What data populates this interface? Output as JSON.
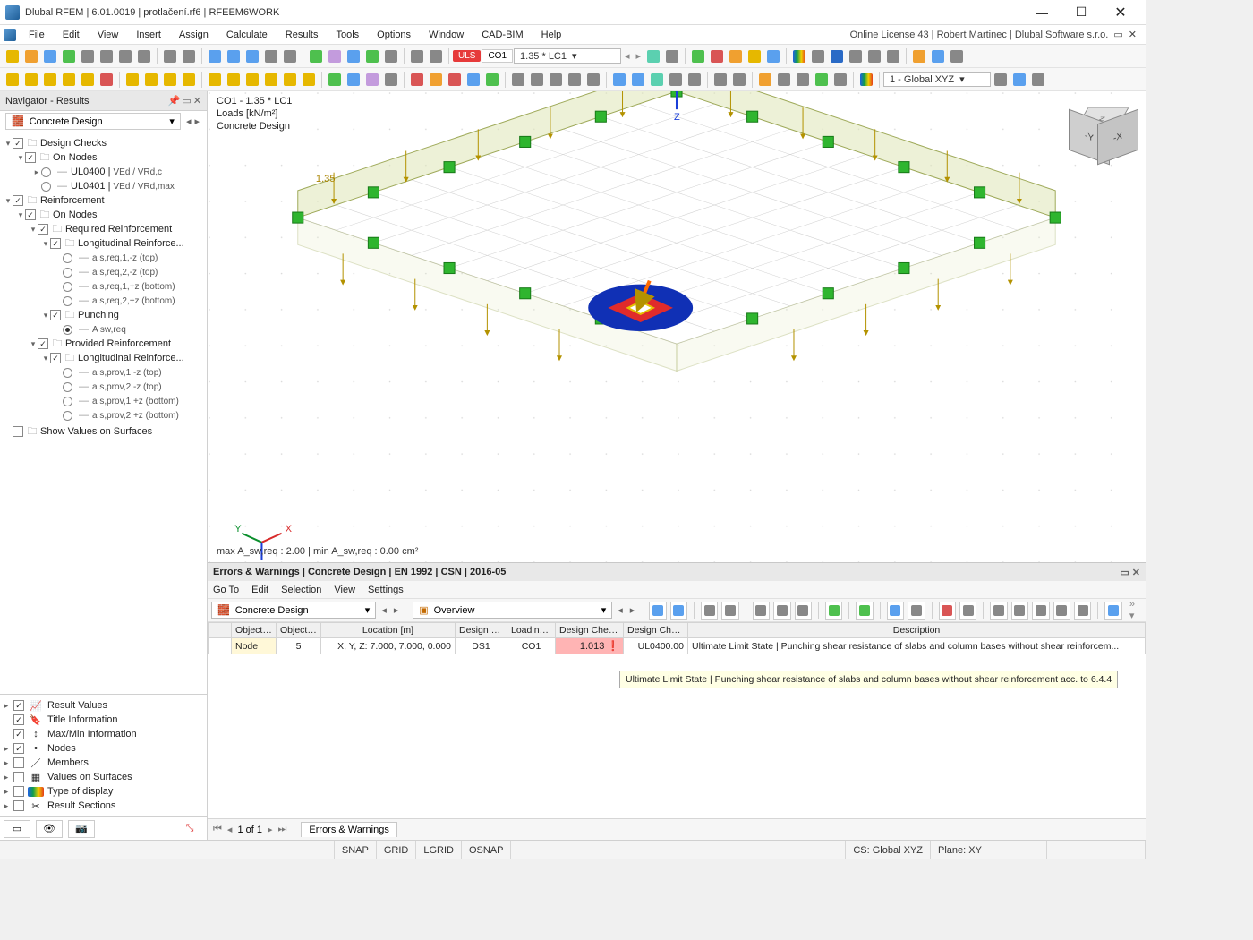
{
  "window": {
    "title": "Dlubal RFEM | 6.01.0019 | protlačení.rf6 | RFEEM6WORK"
  },
  "menubar": {
    "items": [
      "File",
      "Edit",
      "View",
      "Insert",
      "Assign",
      "Calculate",
      "Results",
      "Tools",
      "Options",
      "Window",
      "CAD-BIM",
      "Help"
    ],
    "right": "Online License 43 | Robert Martinec | Dlubal Software s.r.o."
  },
  "toolbar1": {
    "uls_badge": "ULS",
    "co_label": "CO1",
    "combo_label": "1.35 * LC1",
    "cs_label": "1 - Global XYZ"
  },
  "navigator": {
    "title": "Navigator - Results",
    "module": "Concrete Design",
    "tree": {
      "design_checks": "Design Checks",
      "on_nodes": "On Nodes",
      "ul0400": "UL0400 |",
      "ul0400_sub": "VEd / VRd,c",
      "ul0401": "UL0401 |",
      "ul0401_sub": "VEd / VRd,max",
      "reinforcement": "Reinforcement",
      "on_nodes_2": "On Nodes",
      "required": "Required Reinforcement",
      "long_req": "Longitudinal Reinforce...",
      "r1": "a s,req,1,-z (top)",
      "r2": "a s,req,2,-z (top)",
      "r3": "a s,req,1,+z (bottom)",
      "r4": "a s,req,2,+z (bottom)",
      "punching": "Punching",
      "asw": "A sw,req",
      "provided": "Provided Reinforcement",
      "long_prov": "Longitudinal Reinforce...",
      "p1": "a s,prov,1,-z (top)",
      "p2": "a s,prov,2,-z (top)",
      "p3": "a s,prov,1,+z (bottom)",
      "p4": "a s,prov,2,+z (bottom)",
      "show_vals": "Show Values on Surfaces"
    },
    "options": [
      "Result Values",
      "Title Information",
      "Max/Min Information",
      "Nodes",
      "Members",
      "Values on Surfaces",
      "Type of display",
      "Result Sections"
    ]
  },
  "viewport": {
    "line1": "CO1 - 1.35 * LC1",
    "line2": "Loads [kN/m²]",
    "line3": "Concrete Design",
    "factor": "1.35",
    "footer": "max A_sw,req : 2.00 | min A_sw,req : 0.00 cm²"
  },
  "errorsWarnings": {
    "title": "Errors & Warnings | Concrete Design | EN 1992 | CSN | 2016-05",
    "menu": [
      "Go To",
      "Edit",
      "Selection",
      "View",
      "Settings"
    ],
    "combo_module": "Concrete Design",
    "combo_overview": "Overview",
    "tooltip": "Ultimate Limit State | Punching shear resistance of slabs and column bases without shear reinforcement acc. to 6.4.4",
    "headers": {
      "obj_type": "Object Type",
      "obj_no": "Objects No.",
      "location": "Location [m]",
      "situation": "Design Situation",
      "loading": "Loading No.",
      "ratio": "Design Check Ratio η [-]",
      "check_type": "Design Check Type",
      "desc": "Description"
    },
    "row": {
      "obj_type": "Node",
      "obj_no": "5",
      "location": "X, Y, Z: 7.000, 7.000, 0.000",
      "situation": "DS1",
      "loading": "CO1",
      "ratio": "1.013",
      "check_type": "UL0400.00",
      "desc": "Ultimate Limit State | Punching shear resistance of slabs and column bases without shear reinforcem..."
    },
    "pager": "1 of 1",
    "tab": "Errors & Warnings"
  },
  "status": {
    "snap": "SNAP",
    "grid": "GRID",
    "lgrid": "LGRID",
    "osnap": "OSNAP",
    "cs": "CS: Global XYZ",
    "plane": "Plane: XY"
  }
}
